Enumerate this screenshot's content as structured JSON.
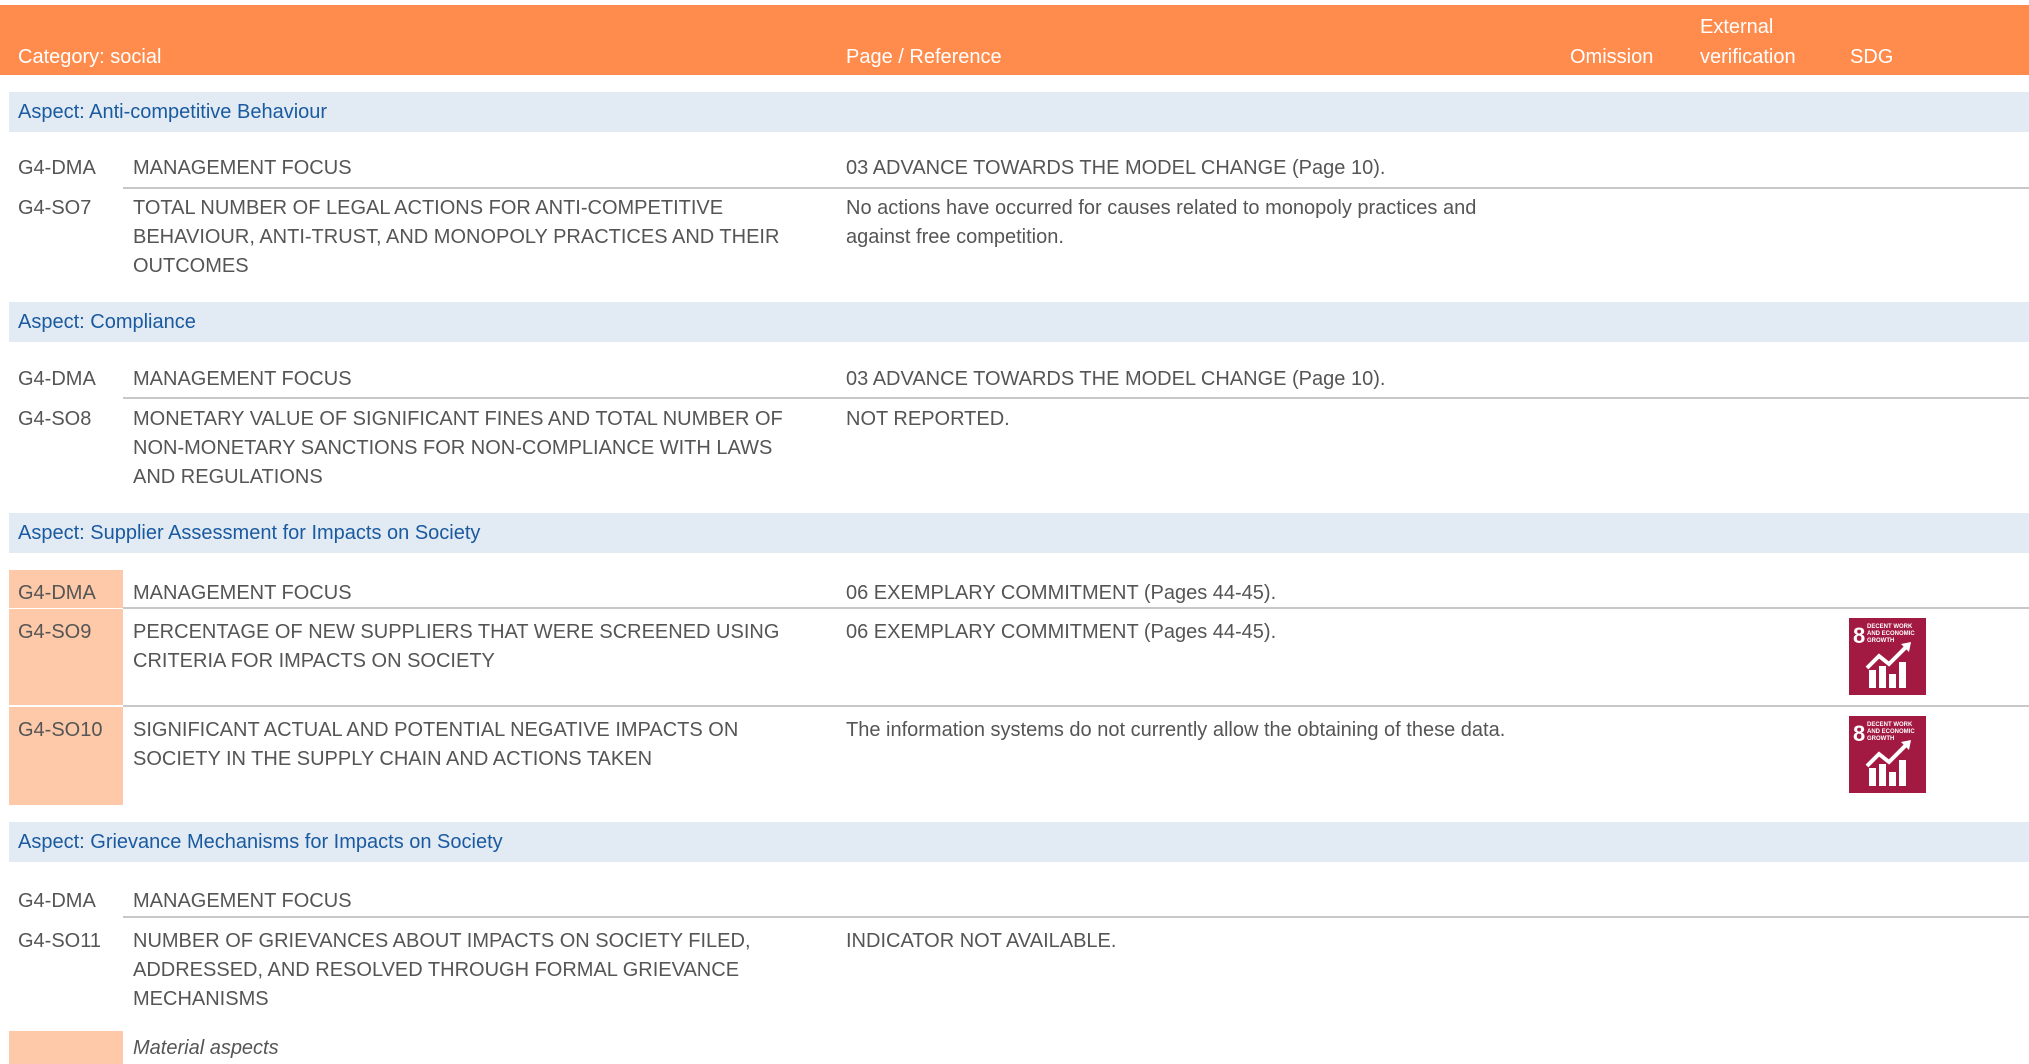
{
  "header": {
    "category": "Category: social",
    "page_reference": "Page / Reference",
    "omission": "Omission",
    "external_verification_line1": "External",
    "external_verification_line2": "verification",
    "sdg": "SDG"
  },
  "aspects": [
    "Aspect: Anti-competitive Behaviour",
    "Aspect: Compliance",
    "Aspect: Supplier Assessment for Impacts on Society",
    "Aspect: Grievance Mechanisms for Impacts on Society"
  ],
  "rows": [
    {
      "code": "G4-DMA",
      "desc": "MANAGEMENT FOCUS",
      "ref": "03 ADVANCE TOWARDS THE MODEL CHANGE (Page 10)."
    },
    {
      "code": "G4-SO7",
      "desc": "TOTAL NUMBER OF LEGAL ACTIONS FOR ANTI-COMPETITIVE BEHAVIOUR, ANTI-TRUST, AND MONOPOLY PRACTICES AND THEIR OUTCOMES",
      "ref": "No actions have occurred for causes related to monopoly practices and against free competition."
    },
    {
      "code": "G4-DMA",
      "desc": "MANAGEMENT FOCUS",
      "ref": "03 ADVANCE TOWARDS THE MODEL CHANGE (Page 10)."
    },
    {
      "code": "G4-SO8",
      "desc": "MONETARY VALUE OF SIGNIFICANT FINES AND TOTAL NUMBER OF NON-MONETARY SANCTIONS FOR NON-COMPLIANCE WITH LAWS AND REGULATIONS",
      "ref": "NOT REPORTED."
    },
    {
      "code": "G4-DMA",
      "desc": "MANAGEMENT FOCUS",
      "ref": "06 EXEMPLARY COMMITMENT (Pages 44-45)."
    },
    {
      "code": "G4-SO9",
      "desc": "PERCENTAGE OF NEW SUPPLIERS THAT WERE SCREENED USING CRITERIA FOR IMPACTS ON SOCIETY",
      "ref": "06 EXEMPLARY COMMITMENT (Pages 44-45)."
    },
    {
      "code": "G4-SO10",
      "desc": "SIGNIFICANT ACTUAL AND POTENTIAL NEGATIVE IMPACTS ON SOCIETY IN THE SUPPLY CHAIN AND ACTIONS TAKEN",
      "ref": "The information systems do not currently allow the obtaining of these data."
    },
    {
      "code": "G4-DMA",
      "desc": "MANAGEMENT FOCUS",
      "ref": ""
    },
    {
      "code": "G4-SO11",
      "desc": "NUMBER OF GRIEVANCES ABOUT IMPACTS ON SOCIETY FILED, ADDRESSED, AND RESOLVED THROUGH FORMAL GRIEVANCE MECHANISMS",
      "ref": "INDICATOR NOT AVAILABLE."
    }
  ],
  "sdg_badge": {
    "number": "8",
    "text": "DECENT WORK AND ECONOMIC GROWTH",
    "icon": "growth-chart-icon",
    "color": "#a21942"
  },
  "legend": {
    "label": "Material aspects",
    "color": "#fdc9a8"
  },
  "colors": {
    "header": "#ff8c4c",
    "aspect_bg": "#e2ebf3",
    "aspect_text": "#1a5aa0",
    "material": "#fdc9a8"
  }
}
